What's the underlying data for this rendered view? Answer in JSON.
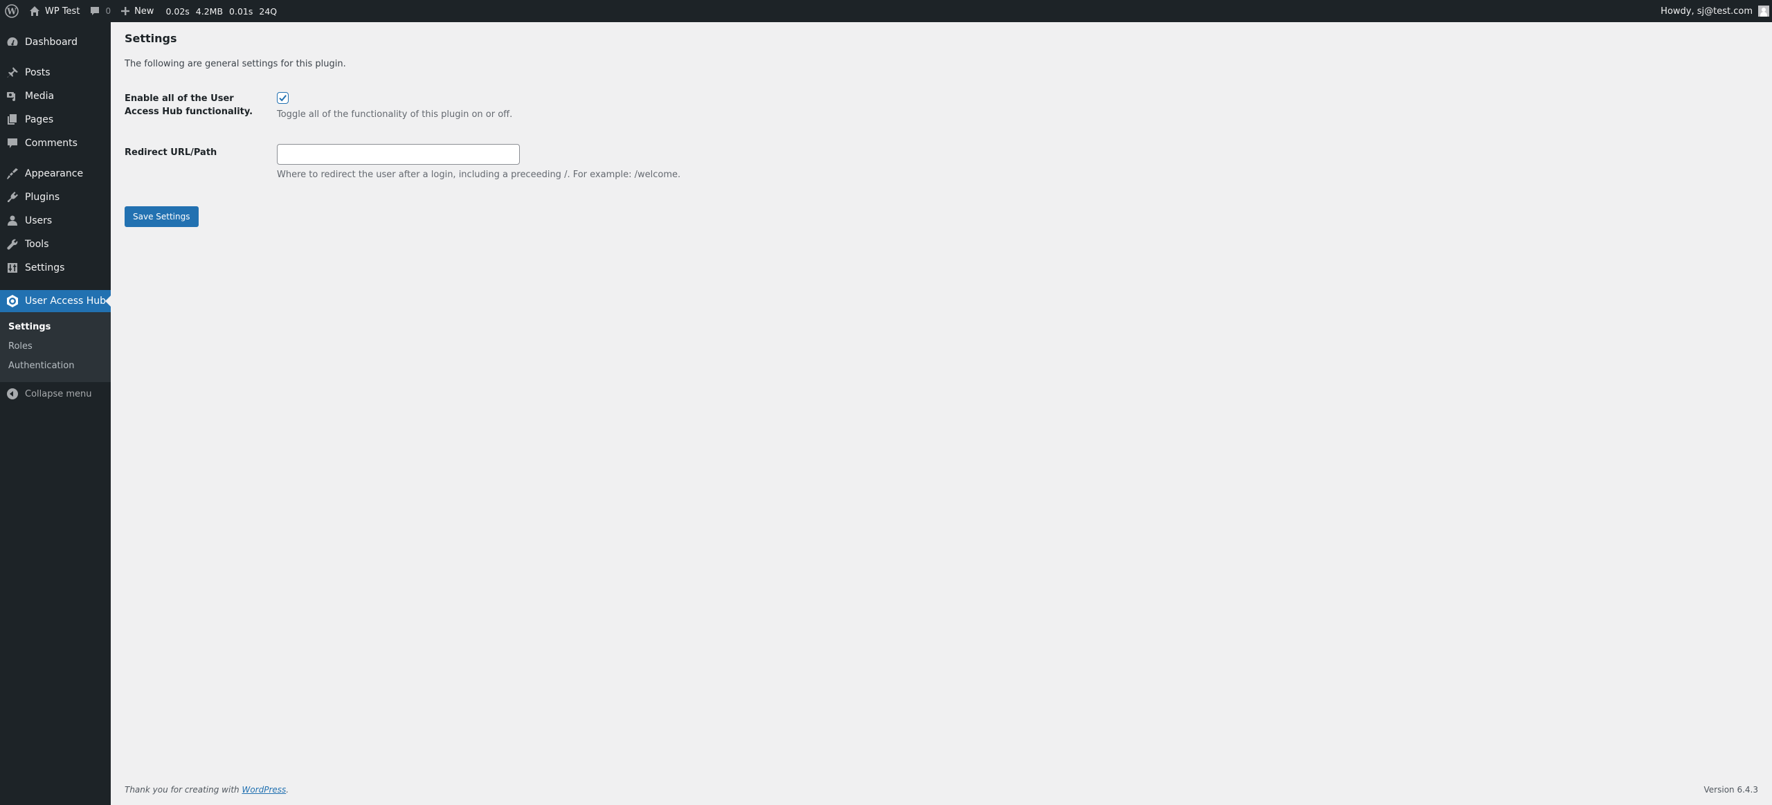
{
  "adminbar": {
    "site_name": "WP Test",
    "comments_count": "0",
    "new_label": "New",
    "query_monitor": {
      "time": "0.02s",
      "memory": "4.2MB",
      "db_time": "0.01s",
      "queries": "24Q"
    },
    "greeting": "Howdy, sj@test.com"
  },
  "sidebar": {
    "items": [
      {
        "label": "Dashboard",
        "icon": "dashboard-icon"
      },
      {
        "label": "Posts",
        "icon": "pin-icon"
      },
      {
        "label": "Media",
        "icon": "media-icon"
      },
      {
        "label": "Pages",
        "icon": "pages-icon"
      },
      {
        "label": "Comments",
        "icon": "comment-icon"
      },
      {
        "label": "Appearance",
        "icon": "paintbrush-icon"
      },
      {
        "label": "Plugins",
        "icon": "plugin-icon"
      },
      {
        "label": "Users",
        "icon": "user-icon"
      },
      {
        "label": "Tools",
        "icon": "wrench-icon"
      },
      {
        "label": "Settings",
        "icon": "sliders-icon"
      },
      {
        "label": "User Access Hub",
        "icon": "hexagon-icon",
        "current": true
      }
    ],
    "submenu": [
      {
        "label": "Settings",
        "current": true
      },
      {
        "label": "Roles"
      },
      {
        "label": "Authentication"
      }
    ],
    "collapse_label": "Collapse menu"
  },
  "main": {
    "title": "Settings",
    "intro": "The following are general settings for this plugin.",
    "fields": {
      "enable": {
        "label": "Enable all of the User Access Hub functionality.",
        "checked": true,
        "description": "Toggle all of the functionality of this plugin on or off."
      },
      "redirect": {
        "label": "Redirect URL/Path",
        "value": "",
        "placeholder": "",
        "description": "Where to redirect the user after a login, including a preceeding /. For example: /welcome."
      }
    },
    "save_label": "Save Settings"
  },
  "footer": {
    "thanks_prefix": "Thank you for creating with ",
    "thanks_link": "WordPress",
    "thanks_suffix": ".",
    "version": "Version 6.4.3"
  },
  "colors": {
    "accent": "#2271b1",
    "adminbar_bg": "#1d2327",
    "submenu_bg": "#2c3338",
    "page_bg": "#f0f0f1"
  }
}
